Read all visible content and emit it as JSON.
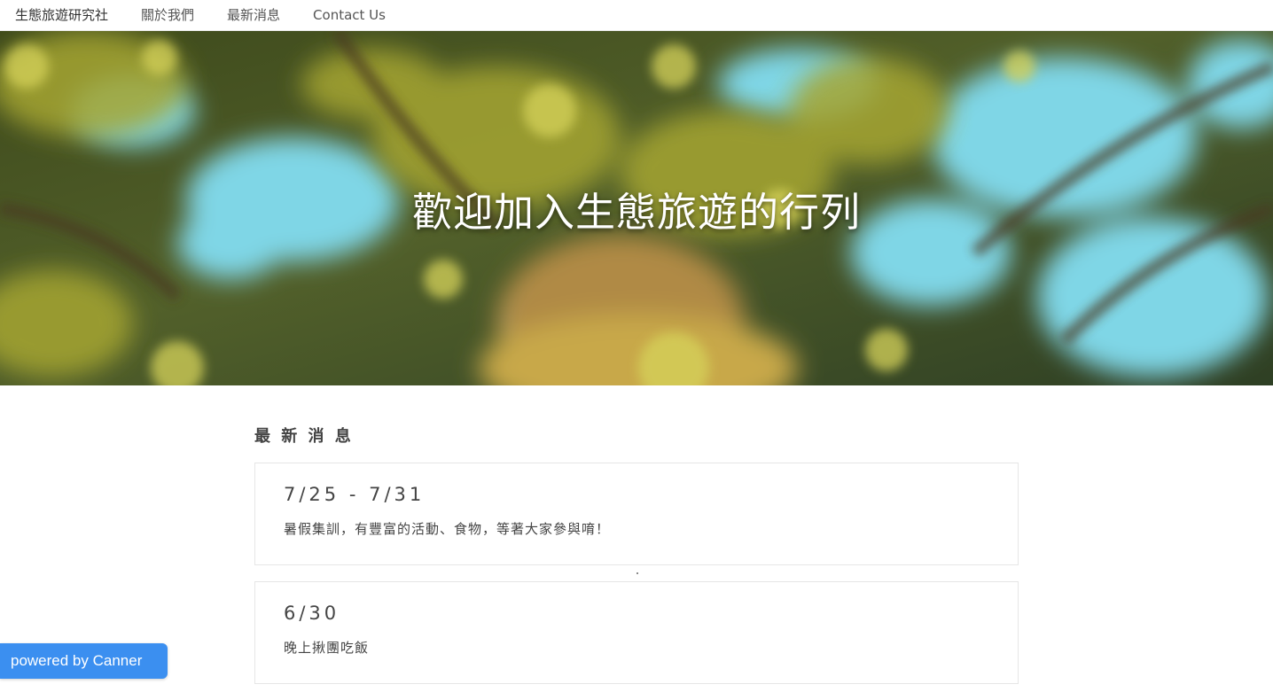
{
  "nav": {
    "brand": "生態旅遊研究社",
    "links": [
      "關於我們",
      "最新消息",
      "Contact Us"
    ]
  },
  "hero": {
    "title": "歡迎加入生態旅遊的行列"
  },
  "news": {
    "heading": "最 新 消 息",
    "items": [
      {
        "date": "7/25 - 7/31",
        "description": "暑假集訓，有豐富的活動、食物，等著大家參與唷！"
      },
      {
        "date": "6/30",
        "description": "晚上揪團吃飯"
      }
    ]
  },
  "badge": {
    "label": "powered by Canner"
  },
  "colors": {
    "badge": "#3b8ff0",
    "text": "#444444"
  }
}
